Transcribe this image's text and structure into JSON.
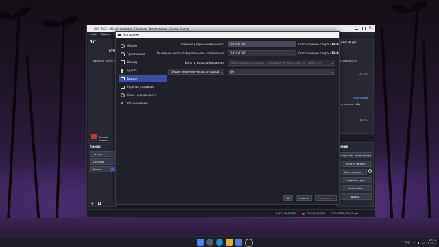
{
  "obs_main": {
    "title": "OBS 30.2.3 (64-bit, windows) - Профиль: Без названия - Сцены: Сцена",
    "menu": [
      "Файл",
      "Правка",
      "Вид"
    ],
    "chat": {
      "header": "Чат",
      "stream_tab": "STRE",
      "welcome": "Welcome to the c",
      "send_message": "Send a messa"
    },
    "scenes": {
      "header": "Сцены",
      "items": [
        "Начало",
        "Браузер",
        "Запись",
        "Си"
      ]
    },
    "right_panel": {
      "header": "Трансляции",
      "card1_text": "ло обычно ХС",
      "card1_count": "27/140",
      "learn_more": "Learn More",
      "card2_text": "ия, только тебя",
      "card2_count": "34/140",
      "button_label": "ение"
    },
    "controls": {
      "header": "ление",
      "buttons": [
        "Запустить трансляцию",
        "Начать запись",
        "Виртуальную камеру",
        "Режим студии",
        "Настройки",
        "Выход"
      ]
    },
    "status": {
      "live": "LIVE: 00:00:00",
      "rec": "REC: 00:00:00",
      "cpu": "CPU: 0.2%, 60.00 fps"
    }
  },
  "settings_dialog": {
    "title": "Настройки",
    "nav": [
      {
        "label": "Общие",
        "icon": "gear-icon",
        "selected": false
      },
      {
        "label": "Трансляция",
        "icon": "broadcast-icon",
        "selected": false
      },
      {
        "label": "Вывод",
        "icon": "output-icon",
        "selected": false
      },
      {
        "label": "Аудио",
        "icon": "speaker-icon",
        "selected": false
      },
      {
        "label": "Видео",
        "icon": "monitor-icon",
        "selected": true
      },
      {
        "label": "Горячие клавиши",
        "icon": "keyboard-icon",
        "selected": false
      },
      {
        "label": "Спец. возможности",
        "icon": "accessibility-icon",
        "selected": false
      },
      {
        "label": "Расширенные",
        "icon": "wrench-icon",
        "selected": false
      }
    ],
    "video": {
      "base_label": "Базовое разрешение (холст)",
      "base_value": "1920x1080",
      "base_aspect_label": "Соотношение сторон",
      "base_aspect_value": "16:9",
      "output_label": "Выходное (масштабированное) разрешение",
      "output_value": "1920x1080",
      "output_aspect_label": "Соотношение сторон",
      "output_aspect_value": "16:9",
      "filter_label": "Фильтр масштабирования",
      "filter_value": "[Разрешения совпадают, уменьшение масштаба не требуется]",
      "fps_type_value": "Общие значения частоты кадров",
      "fps_value": "60"
    },
    "buttons": {
      "ok": "OK",
      "cancel": "Отмена",
      "apply": "Применить"
    }
  },
  "taskbar": {
    "lang": "РУС",
    "time": "22:22",
    "date": "07.11.2024"
  },
  "colors": {
    "accent": "#3b4ea8",
    "rec_red": "#c0392b",
    "purple_button": "#7a3fd6"
  }
}
